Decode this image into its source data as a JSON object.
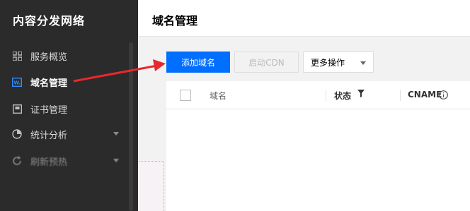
{
  "sidebar": {
    "brand": "内容分发网络",
    "items": [
      {
        "label": "服务概览",
        "icon": "dashboard-grid-icon"
      },
      {
        "label": "域名管理",
        "icon": "domain-icon",
        "active": true
      },
      {
        "label": "证书管理",
        "icon": "certificate-icon"
      },
      {
        "label": "统计分析",
        "icon": "pie-chart-icon",
        "expandable": true
      },
      {
        "label": "刷新预热",
        "icon": "refresh-icon",
        "expandable": true
      }
    ]
  },
  "header": {
    "title": "域名管理"
  },
  "toolbar": {
    "add_domain": "添加域名",
    "enable_cdn": "启动CDN",
    "more_actions": "更多操作"
  },
  "table": {
    "columns": {
      "domain": "域名",
      "status": "状态",
      "cname": "CNAME"
    }
  },
  "colors": {
    "primary": "#006eff",
    "sidebar_bg": "#2b2b2b",
    "arrow": "#e8282c"
  }
}
